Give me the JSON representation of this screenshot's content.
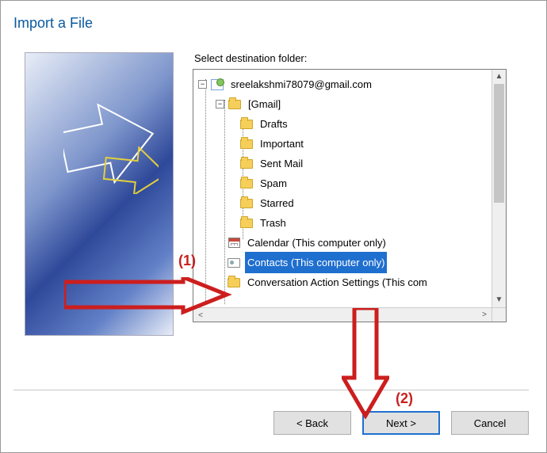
{
  "window": {
    "title": "Import a File"
  },
  "dest_label": "Select destination folder:",
  "tree": {
    "account": "sreelakshmi78079@gmail.com",
    "gmail_label": "[Gmail]",
    "gmail_children": [
      "Drafts",
      "Important",
      "Sent Mail",
      "Spam",
      "Starred",
      "Trash"
    ],
    "calendar": "Calendar (This computer only)",
    "contacts": "Contacts (This computer only)",
    "conversation": "Conversation Action Settings (This com"
  },
  "buttons": {
    "back": "< Back",
    "next": "Next >",
    "cancel": "Cancel"
  },
  "annotations": {
    "one": "(1)",
    "two": "(2)"
  }
}
